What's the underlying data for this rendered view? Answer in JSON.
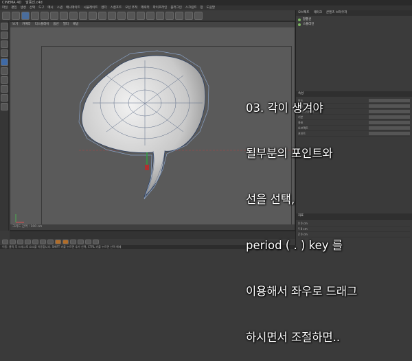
{
  "window": {
    "title": "CINEMA 4D",
    "tabs": [
      "CINEMA 4D",
      "말풍선.c4d"
    ]
  },
  "menu": {
    "items": [
      "파일",
      "편집",
      "생성",
      "선택",
      "도구",
      "메시",
      "스냅",
      "애니메이트",
      "시뮬레이트",
      "렌더",
      "스컬프트",
      "모션 추적",
      "캐릭터",
      "파이프라인",
      "플러그인",
      "스크립트",
      "창",
      "도움말"
    ]
  },
  "viewport": {
    "menu": [
      "보기",
      "카메라",
      "디스플레이",
      "옵션",
      "필터",
      "패널"
    ],
    "view_name": "원근 보기",
    "footer_left": "그리드 간격 : 100 cm"
  },
  "objects": {
    "tabs": [
      "오브젝트",
      "테이크",
      "콘텐츠 브라우저"
    ],
    "rows": [
      "말풍선",
      "스플라인"
    ]
  },
  "attributes": {
    "tab": "속성",
    "rows": [
      "모드",
      "편집",
      "사용자 데이터",
      "기본",
      "좌표",
      "오브젝트",
      "포인트"
    ]
  },
  "coordinates": {
    "tab": "좌표",
    "rows": [
      "X  0 cm",
      "Y  0 cm",
      "Z  0 cm"
    ]
  },
  "statusbar": {
    "text": "이동: 클릭 후 드래그로 요소를 이동합니다. SHIFT 키를 누르면 추가 선택, CTRL 키를 누르면 선택 해제"
  },
  "caption": {
    "line1": "03. 각이 생겨야",
    "line2": "될부분의 포인트와",
    "line3": "선을 선택,",
    "line4": "period ( . ) key 를",
    "line5": "이용해서 좌우로 드래그",
    "line6": "하시면서 조절하면.."
  },
  "colors": {
    "accent": "#3f6aa6",
    "caption_text": "#ffffff"
  }
}
